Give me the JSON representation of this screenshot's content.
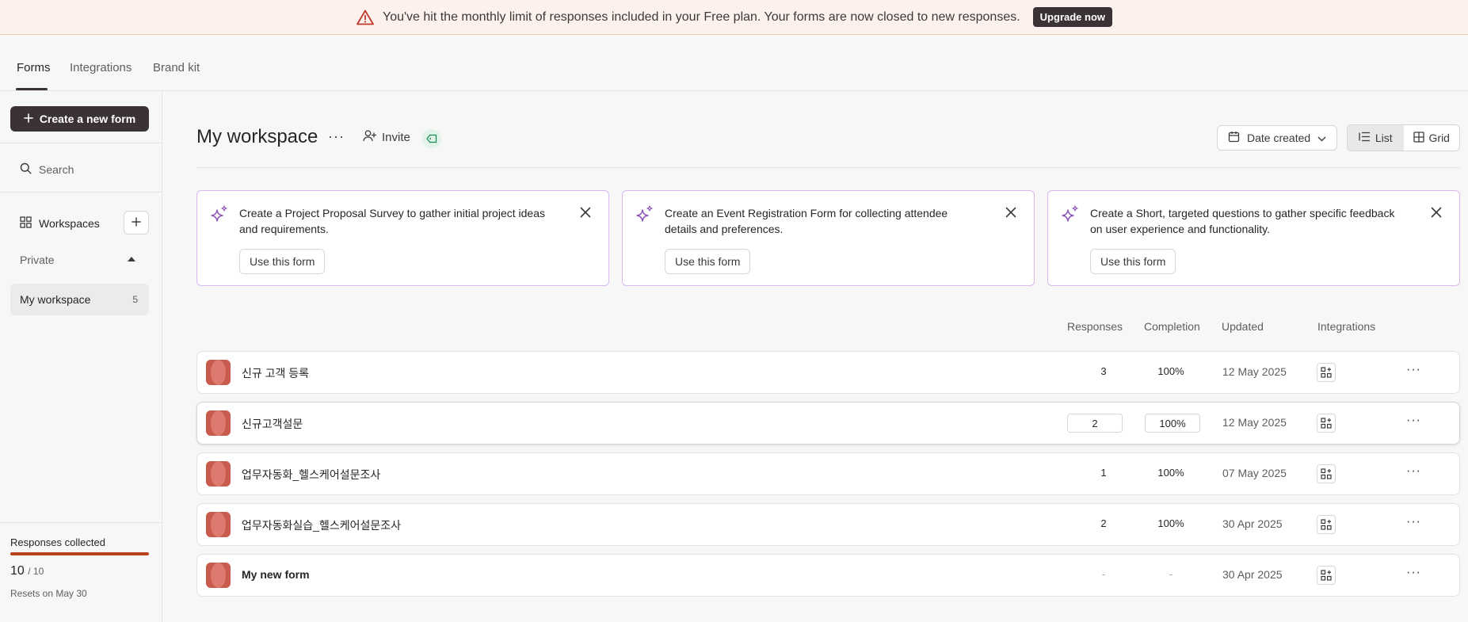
{
  "banner": {
    "message": "You've hit the monthly limit of responses included in your Free plan. Your forms are now closed to new responses.",
    "upgrade_label": "Upgrade now",
    "icon": "warning-triangle-icon"
  },
  "tabs": [
    {
      "label": "Forms",
      "active": true
    },
    {
      "label": "Integrations",
      "active": false
    },
    {
      "label": "Brand kit",
      "active": false
    }
  ],
  "sidebar": {
    "create_label": "Create a new form",
    "search_label": "Search",
    "workspaces_label": "Workspaces",
    "private_label": "Private",
    "workspace": {
      "name": "My workspace",
      "count": "5"
    },
    "responses": {
      "title": "Responses collected",
      "used": "10",
      "limit": "/ 10",
      "usage_fraction": 1.0,
      "reset_text": "Resets on May 30"
    }
  },
  "main": {
    "title": "My workspace",
    "more_label": "···",
    "invite_label": "Invite",
    "sort_label": "Date created",
    "view": {
      "list_label": "List",
      "grid_label": "Grid",
      "active": "list"
    }
  },
  "suggestions": [
    {
      "text": "Create a Project Proposal Survey to gather initial project ideas and requirements.",
      "button": "Use this form"
    },
    {
      "text": "Create an Event Registration Form for collecting attendee details and preferences.",
      "button": "Use this form"
    },
    {
      "text": "Create a Short, targeted questions to gather specific feedback on user experience and functionality.",
      "button": "Use this form"
    }
  ],
  "table": {
    "headers": {
      "responses": "Responses",
      "completion": "Completion",
      "updated": "Updated",
      "integrations": "Integrations"
    },
    "rows": [
      {
        "name": "신규 고객 등록",
        "responses": "3",
        "completion": "100%",
        "updated": "12 May 2025",
        "bold": false
      },
      {
        "name": "신규고객설문",
        "responses": "2",
        "completion": "100%",
        "updated": "12 May 2025",
        "bold": false
      },
      {
        "name": "업무자동화_헬스케어설문조사",
        "responses": "1",
        "completion": "100%",
        "updated": "07 May 2025",
        "bold": false
      },
      {
        "name": "업무자동화실습_헬스케어설문조사",
        "responses": "2",
        "completion": "100%",
        "updated": "30 Apr 2025",
        "bold": false
      },
      {
        "name": "My new form",
        "responses": "-",
        "completion": "-",
        "updated": "30 Apr 2025",
        "bold": true
      }
    ]
  },
  "colors": {
    "accent_dark": "#3b3238",
    "form_icon": "#c85a4e",
    "card_border": "#d9b8f0",
    "usage_bar": "#b8441a"
  }
}
